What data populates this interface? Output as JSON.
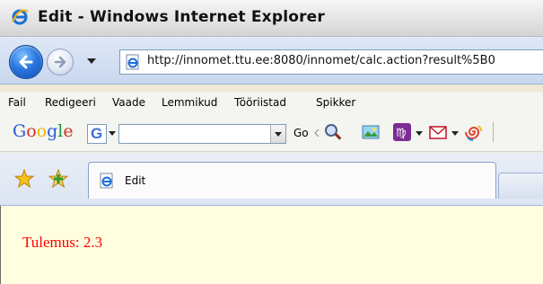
{
  "window": {
    "title": "Edit - Windows Internet Explorer"
  },
  "navigation": {
    "address_url": "http://innomet.ttu.ee:8080/innomet/calc.action?result%5B0"
  },
  "menu": {
    "items": [
      "Fail",
      "Redigeeri",
      "Vaade",
      "Lemmikud",
      "Tööriistad",
      "Spikker"
    ]
  },
  "google_toolbar": {
    "logo": [
      "G",
      "o",
      "o",
      "g",
      "l",
      "e"
    ],
    "logo_colors": [
      "#2a5bd7",
      "#d62d20",
      "#f3b100",
      "#2a5bd7",
      "#159b3c",
      "#d62d20"
    ],
    "search_value": "",
    "go_label": "Go",
    "icons": [
      "magnifier-icon",
      "news-icon",
      "horoscope-icon",
      "mail-icon",
      "spiral-icon"
    ]
  },
  "tabs": [
    {
      "label": "Edit",
      "active": true
    }
  ],
  "content": {
    "result_text": "Tulemus: 2.3",
    "background_color": "#ffffe0",
    "text_color": "#ff0000"
  }
}
